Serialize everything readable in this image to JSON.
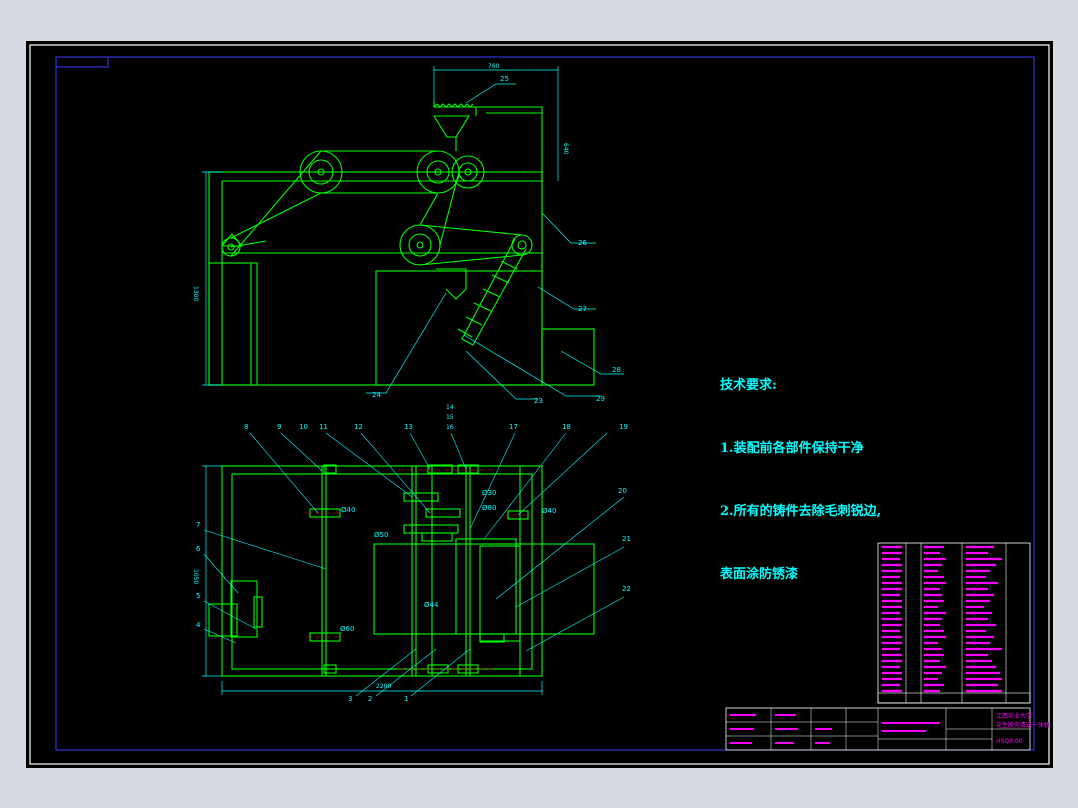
{
  "tech_requirements": {
    "title": "技术要求:",
    "line1": "1.装配前各部件保持干净",
    "line2": "2.所有的铸件去除毛刺锐边,",
    "line3": "表面涂防锈漆"
  },
  "callouts": {
    "top": [
      "25",
      "26",
      "27",
      "28",
      "29",
      "23",
      "24"
    ],
    "plan": [
      "8",
      "9",
      "10",
      "11",
      "12",
      "13",
      "14",
      "15",
      "16",
      "17",
      "18",
      "19",
      "20",
      "21",
      "22",
      "7",
      "6",
      "5",
      "4",
      "3",
      "2",
      "1"
    ]
  },
  "dimensions": {
    "top_width": "760",
    "hopper_height": "640",
    "side_height": "1300",
    "plan_height": "1050",
    "plan_width": "2200",
    "bearing_1": "Ø40",
    "bearing_2": "Ø30",
    "bearing_3": "Ø80",
    "bearing_4": "Ø50",
    "bearing_5": "Ø40",
    "bearing_6": "Ø44",
    "bearing_7": "Ø60",
    "fit": "H7/m6"
  },
  "title_block": {
    "school": "江西农业大学",
    "drawing_name": "花生脱壳清选一体机",
    "drawing_no": "HSQX-00"
  },
  "colors": {
    "sheet": "#000000",
    "outer_frame": "#ffffff",
    "geometry": "#00ff00",
    "dimension": "#00ffff",
    "table": "#ff00ff",
    "table_lines": "#ffffff",
    "center_line": "#ff0000"
  }
}
